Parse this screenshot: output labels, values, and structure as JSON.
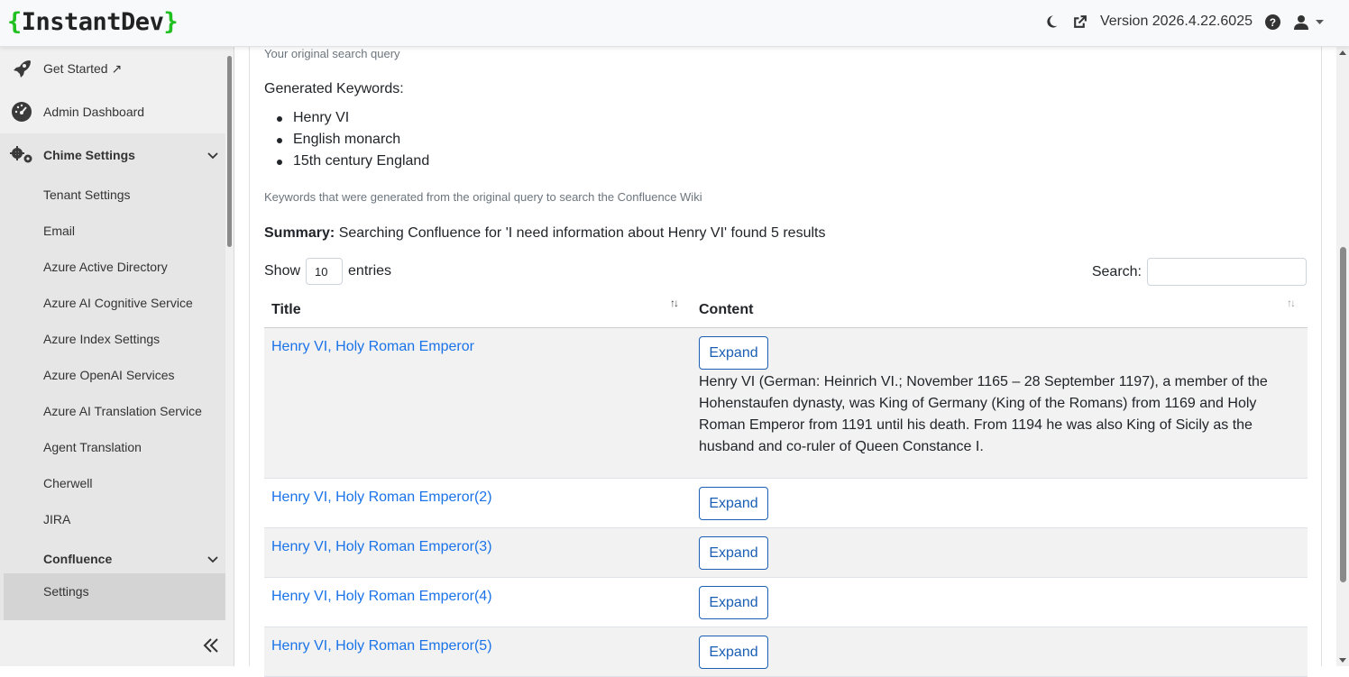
{
  "brand": {
    "open": "{",
    "name": "InstantDev",
    "close": "}"
  },
  "header": {
    "version": "Version 2026.4.22.6025"
  },
  "sidebar": {
    "items": [
      {
        "label": "Get Started ↗",
        "icon": "rocket-icon"
      },
      {
        "label": "Admin Dashboard",
        "icon": "dashboard-gauge-icon"
      },
      {
        "label": "Chime Settings",
        "icon": "gears-icon"
      }
    ],
    "sub_items": [
      "Tenant Settings",
      "Email",
      "Azure Active Directory",
      "Azure AI Cognitive Service",
      "Azure Index Settings",
      "Azure OpenAI Services",
      "Azure AI Translation Service",
      "Agent Translation",
      "Cherwell",
      "JIRA"
    ],
    "confluence": {
      "label": "Confluence",
      "settings": "Settings"
    }
  },
  "main": {
    "query_hint": "Your original search query",
    "keywords_label": "Generated Keywords:",
    "keywords": [
      "Henry VI",
      "English monarch",
      "15th century England"
    ],
    "keywords_hint": "Keywords that were generated from the original query to search the Confluence Wiki",
    "summary_label": "Summary:",
    "summary_text": "Searching Confluence for 'I need information about Henry VI' found 5 results",
    "show_label": "Show",
    "show_value": "10",
    "entries_label": "entries",
    "search_label": "Search:"
  },
  "table": {
    "columns": [
      "Title",
      "Content"
    ],
    "rows": [
      {
        "title": "Henry VI, Holy Roman Emperor",
        "button": "Expand",
        "content": "Henry VI (German: Heinrich VI.; November 1165 – 28 September 1197), a member of the Hohenstaufen dynasty, was King of Germany (King of the Romans) from 1169 and Holy Roman Emperor from 1191 until his death. From 1194 he was also King of Sicily as the husband and co-ruler of Queen Constance I."
      },
      {
        "title": "Henry VI, Holy Roman Emperor(2)",
        "button": "Expand"
      },
      {
        "title": "Henry VI, Holy Roman Emperor(3)",
        "button": "Expand"
      },
      {
        "title": "Henry VI, Holy Roman Emperor(4)",
        "button": "Expand"
      },
      {
        "title": "Henry VI, Holy Roman Emperor(5)",
        "button": "Expand"
      }
    ]
  }
}
